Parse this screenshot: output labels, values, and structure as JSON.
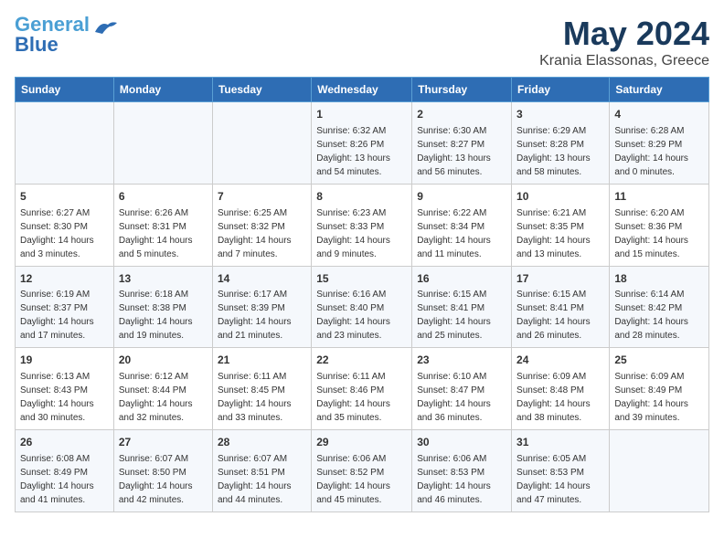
{
  "logo": {
    "line1": "General",
    "line2": "Blue"
  },
  "title": "May 2024",
  "subtitle": "Krania Elassonas, Greece",
  "days_header": [
    "Sunday",
    "Monday",
    "Tuesday",
    "Wednesday",
    "Thursday",
    "Friday",
    "Saturday"
  ],
  "weeks": [
    [
      {
        "day": "",
        "info": ""
      },
      {
        "day": "",
        "info": ""
      },
      {
        "day": "",
        "info": ""
      },
      {
        "day": "1",
        "info": "Sunrise: 6:32 AM\nSunset: 8:26 PM\nDaylight: 13 hours\nand 54 minutes."
      },
      {
        "day": "2",
        "info": "Sunrise: 6:30 AM\nSunset: 8:27 PM\nDaylight: 13 hours\nand 56 minutes."
      },
      {
        "day": "3",
        "info": "Sunrise: 6:29 AM\nSunset: 8:28 PM\nDaylight: 13 hours\nand 58 minutes."
      },
      {
        "day": "4",
        "info": "Sunrise: 6:28 AM\nSunset: 8:29 PM\nDaylight: 14 hours\nand 0 minutes."
      }
    ],
    [
      {
        "day": "5",
        "info": "Sunrise: 6:27 AM\nSunset: 8:30 PM\nDaylight: 14 hours\nand 3 minutes."
      },
      {
        "day": "6",
        "info": "Sunrise: 6:26 AM\nSunset: 8:31 PM\nDaylight: 14 hours\nand 5 minutes."
      },
      {
        "day": "7",
        "info": "Sunrise: 6:25 AM\nSunset: 8:32 PM\nDaylight: 14 hours\nand 7 minutes."
      },
      {
        "day": "8",
        "info": "Sunrise: 6:23 AM\nSunset: 8:33 PM\nDaylight: 14 hours\nand 9 minutes."
      },
      {
        "day": "9",
        "info": "Sunrise: 6:22 AM\nSunset: 8:34 PM\nDaylight: 14 hours\nand 11 minutes."
      },
      {
        "day": "10",
        "info": "Sunrise: 6:21 AM\nSunset: 8:35 PM\nDaylight: 14 hours\nand 13 minutes."
      },
      {
        "day": "11",
        "info": "Sunrise: 6:20 AM\nSunset: 8:36 PM\nDaylight: 14 hours\nand 15 minutes."
      }
    ],
    [
      {
        "day": "12",
        "info": "Sunrise: 6:19 AM\nSunset: 8:37 PM\nDaylight: 14 hours\nand 17 minutes."
      },
      {
        "day": "13",
        "info": "Sunrise: 6:18 AM\nSunset: 8:38 PM\nDaylight: 14 hours\nand 19 minutes."
      },
      {
        "day": "14",
        "info": "Sunrise: 6:17 AM\nSunset: 8:39 PM\nDaylight: 14 hours\nand 21 minutes."
      },
      {
        "day": "15",
        "info": "Sunrise: 6:16 AM\nSunset: 8:40 PM\nDaylight: 14 hours\nand 23 minutes."
      },
      {
        "day": "16",
        "info": "Sunrise: 6:15 AM\nSunset: 8:41 PM\nDaylight: 14 hours\nand 25 minutes."
      },
      {
        "day": "17",
        "info": "Sunrise: 6:15 AM\nSunset: 8:41 PM\nDaylight: 14 hours\nand 26 minutes."
      },
      {
        "day": "18",
        "info": "Sunrise: 6:14 AM\nSunset: 8:42 PM\nDaylight: 14 hours\nand 28 minutes."
      }
    ],
    [
      {
        "day": "19",
        "info": "Sunrise: 6:13 AM\nSunset: 8:43 PM\nDaylight: 14 hours\nand 30 minutes."
      },
      {
        "day": "20",
        "info": "Sunrise: 6:12 AM\nSunset: 8:44 PM\nDaylight: 14 hours\nand 32 minutes."
      },
      {
        "day": "21",
        "info": "Sunrise: 6:11 AM\nSunset: 8:45 PM\nDaylight: 14 hours\nand 33 minutes."
      },
      {
        "day": "22",
        "info": "Sunrise: 6:11 AM\nSunset: 8:46 PM\nDaylight: 14 hours\nand 35 minutes."
      },
      {
        "day": "23",
        "info": "Sunrise: 6:10 AM\nSunset: 8:47 PM\nDaylight: 14 hours\nand 36 minutes."
      },
      {
        "day": "24",
        "info": "Sunrise: 6:09 AM\nSunset: 8:48 PM\nDaylight: 14 hours\nand 38 minutes."
      },
      {
        "day": "25",
        "info": "Sunrise: 6:09 AM\nSunset: 8:49 PM\nDaylight: 14 hours\nand 39 minutes."
      }
    ],
    [
      {
        "day": "26",
        "info": "Sunrise: 6:08 AM\nSunset: 8:49 PM\nDaylight: 14 hours\nand 41 minutes."
      },
      {
        "day": "27",
        "info": "Sunrise: 6:07 AM\nSunset: 8:50 PM\nDaylight: 14 hours\nand 42 minutes."
      },
      {
        "day": "28",
        "info": "Sunrise: 6:07 AM\nSunset: 8:51 PM\nDaylight: 14 hours\nand 44 minutes."
      },
      {
        "day": "29",
        "info": "Sunrise: 6:06 AM\nSunset: 8:52 PM\nDaylight: 14 hours\nand 45 minutes."
      },
      {
        "day": "30",
        "info": "Sunrise: 6:06 AM\nSunset: 8:53 PM\nDaylight: 14 hours\nand 46 minutes."
      },
      {
        "day": "31",
        "info": "Sunrise: 6:05 AM\nSunset: 8:53 PM\nDaylight: 14 hours\nand 47 minutes."
      },
      {
        "day": "",
        "info": ""
      }
    ]
  ]
}
